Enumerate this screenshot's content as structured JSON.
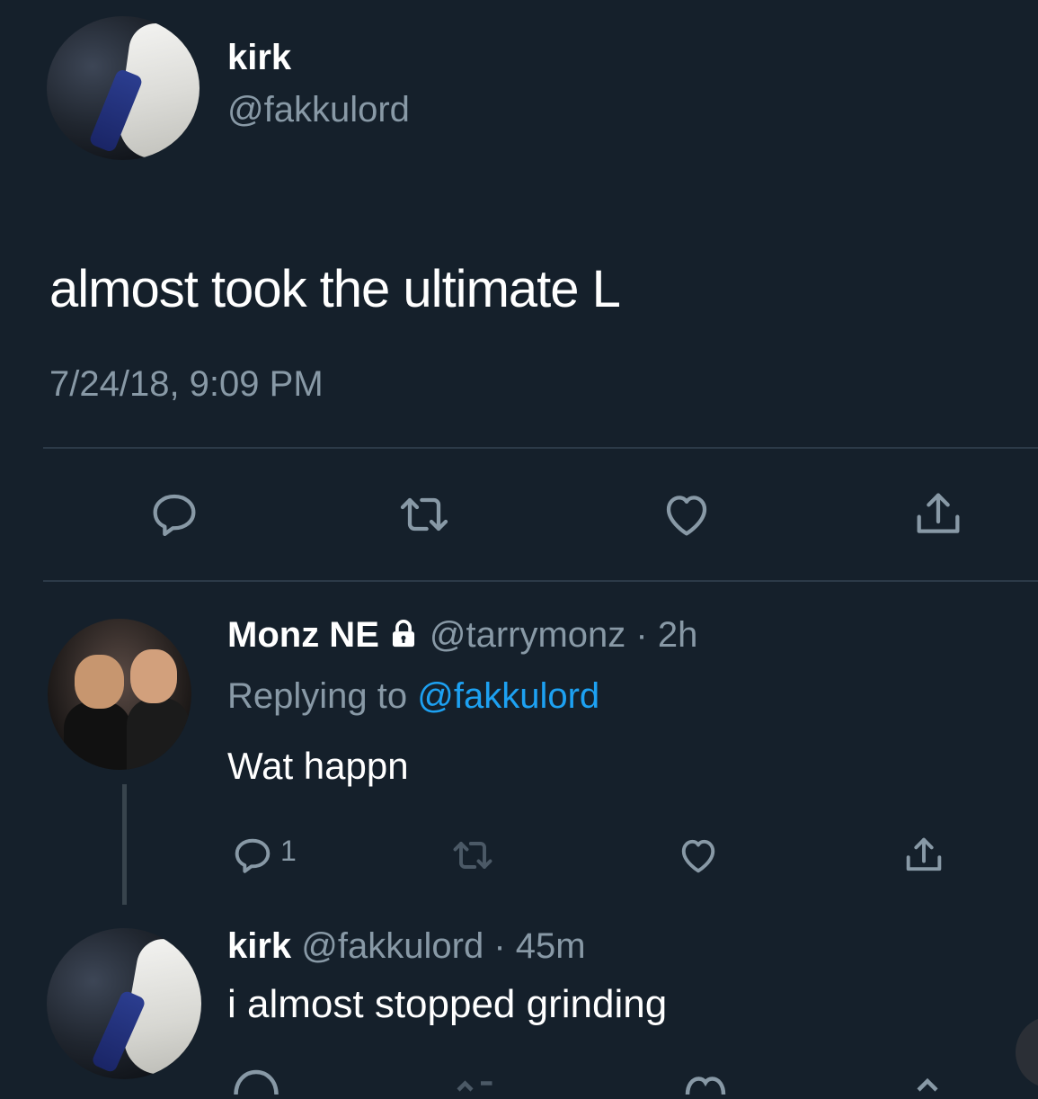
{
  "tweet": {
    "author_name": "kirk",
    "author_handle": "@fakkulord",
    "text": "almost took the ultimate L",
    "timestamp": "7/24/18, 9:09 PM",
    "actions": [
      "reply-icon",
      "retweet-icon",
      "like-icon",
      "share-icon"
    ]
  },
  "reply": {
    "author_name": "Monz NE",
    "locked": true,
    "meta": "@tarrymonz · 2h",
    "replying_prefix": "Replying to",
    "replying_mention": "@fakkulord",
    "text": "Wat happn",
    "reply_count": "1",
    "actions": [
      "reply-icon",
      "retweet-icon",
      "like-icon",
      "share-icon"
    ]
  },
  "reply2": {
    "author_name": "kirk",
    "meta": "@fakkulord · 45m",
    "text": "i almost stopped grinding"
  },
  "colors": {
    "background": "#15202b",
    "secondary_text": "#8899a6",
    "link": "#1da1f2"
  }
}
